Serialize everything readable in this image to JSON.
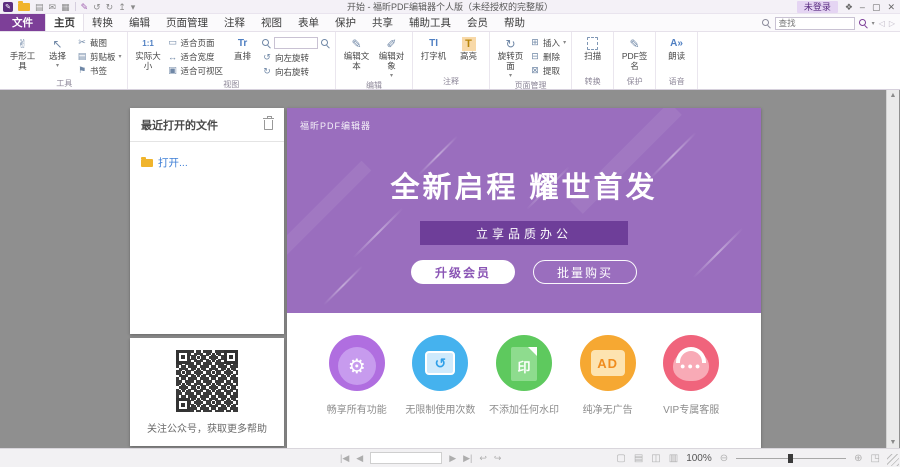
{
  "colors": {
    "accent": "#7d3f98",
    "banner_bg": "#9a6ebe",
    "badge_bg": "#6e3e99",
    "content_bg": "#8f8f8f",
    "link": "#3f7fd6",
    "feature_purple": "#b06ee0",
    "feature_blue": "#45b2ee",
    "feature_green": "#5ec95e",
    "feature_orange": "#f6a832",
    "feature_pink": "#f0647c"
  },
  "window": {
    "title": "开始 - 福昕PDF编辑器个人版（未经授权的完整版）",
    "login_label": "未登录"
  },
  "tabs": [
    {
      "label": "文件"
    },
    {
      "label": "主页"
    },
    {
      "label": "转换"
    },
    {
      "label": "编辑"
    },
    {
      "label": "页面管理"
    },
    {
      "label": "注释"
    },
    {
      "label": "视图"
    },
    {
      "label": "表单"
    },
    {
      "label": "保护"
    },
    {
      "label": "共享"
    },
    {
      "label": "辅助工具"
    },
    {
      "label": "会员"
    },
    {
      "label": "帮助"
    }
  ],
  "find": {
    "placeholder": "查找"
  },
  "ribbon": {
    "hand": "手形工具",
    "select": "选择",
    "snapshot": "截图",
    "clipboard": "剪贴板",
    "bookmark": "书签",
    "actual_size": "实际大小",
    "fit_page": "适合页面",
    "fit_width": "适合宽度",
    "fit_visible": "适合可视区",
    "vertical": "直排",
    "rotate_left": "向左旋转",
    "rotate_right": "向右旋转",
    "edit_text": "编辑文本",
    "edit_object": "编辑对象",
    "typewriter": "打字机",
    "highlight": "高亮",
    "rotate_pages": "旋转页面",
    "insert": "插入",
    "delete": "删除",
    "extract": "提取",
    "scan": "扫描",
    "pdf_sign": "PDF签名",
    "read_aloud": "朗读",
    "groups": {
      "tools": "工具",
      "view": "视图",
      "edit": "编辑",
      "comment": "注释",
      "pages": "页面管理",
      "convert": "转换",
      "protect": "保护",
      "voice": "语音"
    }
  },
  "recent": {
    "title": "最近打开的文件",
    "open_label": "打开..."
  },
  "qr": {
    "caption": "关注公众号，获取更多帮助"
  },
  "banner": {
    "brand": "福昕PDF编辑器",
    "headline": "全新启程 耀世首发",
    "badge": "立享品质办公",
    "upgrade_label": "升级会员",
    "bulk_label": "批量购买"
  },
  "features": [
    {
      "label": "畅享所有功能"
    },
    {
      "label": "无限制使用次数"
    },
    {
      "label": "不添加任何水印",
      "badge": "印"
    },
    {
      "label": "纯净无广告",
      "badge": "AD"
    },
    {
      "label": "VIP专属客服"
    }
  ],
  "statusbar": {
    "zoom": "100%"
  },
  "icons": {
    "app_logo": "✎",
    "save": "▤",
    "email": "✉",
    "print": "▦",
    "stamp_pen": "✎",
    "undo": "↺",
    "redo": "↻",
    "share": "↥",
    "caret": "▾",
    "hand": "✌",
    "select": "↖",
    "snapshot": "✂",
    "clipboard": "▤",
    "bookmark": "⚑",
    "actual_size": "1:1",
    "fit_page": "▭",
    "fit_width": "↔",
    "fit_visible": "▣",
    "vertical": "Tr",
    "rotate_left": "↺",
    "rotate_right": "↻",
    "edit_text": "✎",
    "edit_object": "✐",
    "typewriter": "TI",
    "highlight": "T",
    "rotate_pages": "↻",
    "insert": "⊞",
    "delete": "⊟",
    "extract": "⊠",
    "pdf_sign": "✎",
    "read_aloud": "A»",
    "grid": "❖",
    "minimize": "–",
    "maximize": "▢",
    "close": "✕",
    "prev_arrow": "◁",
    "next_arrow": "▷",
    "first_page": "|◀",
    "prev_page": "◀",
    "next_page": "▶",
    "last_page": "▶|",
    "prev_view": "↩",
    "next_view": "↪",
    "layout_single": "▢",
    "layout_continuous": "▤",
    "layout_facing": "◫",
    "layout_facing_continuous": "▥",
    "zoom_out": "⊖",
    "zoom_in": "⊕",
    "fit_screen": "◳",
    "scroll_up": "▲",
    "scroll_down": "▼",
    "gear": "⚙",
    "rotate_feature": "↺",
    "dots": "●●●"
  }
}
